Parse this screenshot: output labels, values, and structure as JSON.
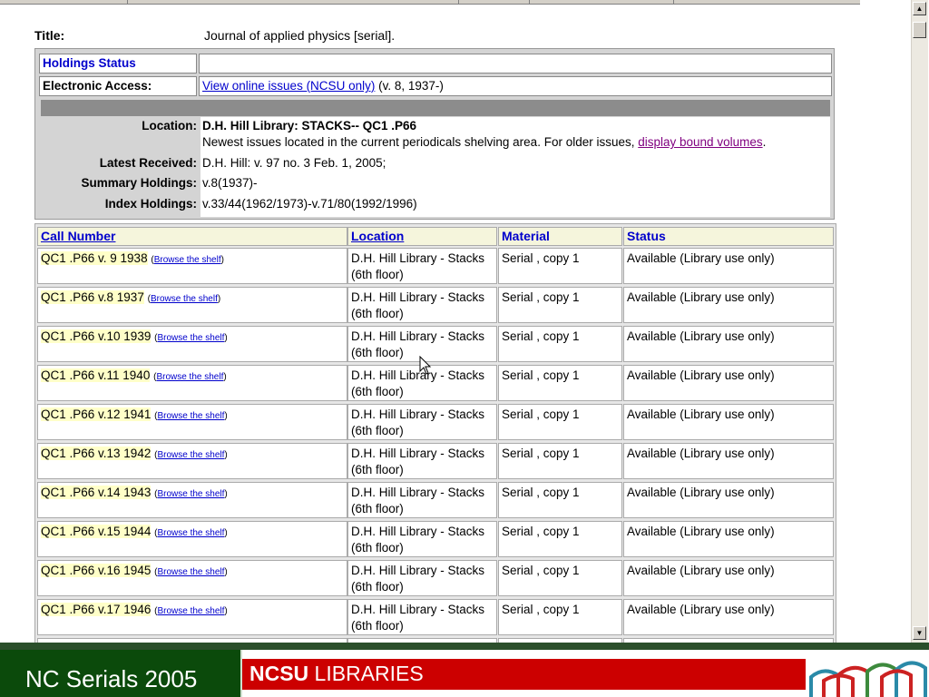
{
  "record": {
    "title_label": "Title:",
    "title_value": "Journal of applied physics [serial].",
    "holdings_status_label": "Holdings Status",
    "holdings_status_value": "",
    "electronic_access_label": "Electronic Access:",
    "electronic_access_link": "View online issues (NCSU only)",
    "electronic_access_note": "(v. 8, 1937-)",
    "location_label": "Location:",
    "location_value": "D.H. Hill Library: STACKS-- QC1 .P66",
    "location_note": "Newest issues located in the current periodicals shelving area. For older issues,",
    "location_link": "display bound volumes",
    "location_note_end": ".",
    "latest_received_label": "Latest Received:",
    "latest_received_value": "D.H. Hill: v. 97 no. 3 Feb. 1, 2005;",
    "summary_holdings_label": "Summary Holdings:",
    "summary_holdings_value": "v.8(1937)-",
    "index_holdings_label": "Index Holdings:",
    "index_holdings_value": "v.33/44(1962/1973)-v.71/80(1992/1996)"
  },
  "items_table": {
    "headers": [
      "Call Number",
      "Location",
      "Material",
      "Status"
    ],
    "browse_label": "Browse the shelf",
    "rows": [
      {
        "call": "QC1 .P66 v. 9 1938",
        "location1": "D.H. Hill Library - Stacks",
        "location2": "(6th floor)",
        "material": "Serial , copy 1",
        "status": "Available (Library use only)"
      },
      {
        "call": "QC1 .P66 v.8 1937",
        "location1": "D.H. Hill Library - Stacks",
        "location2": "(6th floor)",
        "material": "Serial , copy 1",
        "status": "Available (Library use only)"
      },
      {
        "call": "QC1 .P66 v.10 1939",
        "location1": "D.H. Hill Library - Stacks",
        "location2": "(6th floor)",
        "material": "Serial , copy 1",
        "status": "Available (Library use only)"
      },
      {
        "call": "QC1 .P66 v.11 1940",
        "location1": "D.H. Hill Library - Stacks",
        "location2": "(6th floor)",
        "material": "Serial , copy 1",
        "status": "Available (Library use only)"
      },
      {
        "call": "QC1 .P66 v.12 1941",
        "location1": "D.H. Hill Library - Stacks",
        "location2": "(6th floor)",
        "material": "Serial , copy 1",
        "status": "Available (Library use only)"
      },
      {
        "call": "QC1 .P66 v.13 1942",
        "location1": "D.H. Hill Library - Stacks",
        "location2": "(6th floor)",
        "material": "Serial , copy 1",
        "status": "Available (Library use only)"
      },
      {
        "call": "QC1 .P66 v.14 1943",
        "location1": "D.H. Hill Library - Stacks",
        "location2": "(6th floor)",
        "material": "Serial , copy 1",
        "status": "Available (Library use only)"
      },
      {
        "call": "QC1 .P66 v.15 1944",
        "location1": "D.H. Hill Library - Stacks",
        "location2": "(6th floor)",
        "material": "Serial , copy 1",
        "status": "Available (Library use only)"
      },
      {
        "call": "QC1 .P66 v.16 1945",
        "location1": "D.H. Hill Library - Stacks",
        "location2": "(6th floor)",
        "material": "Serial , copy 1",
        "status": "Available (Library use only)"
      },
      {
        "call": "QC1 .P66 v.17 1946",
        "location1": "D.H. Hill Library - Stacks",
        "location2": "(6th floor)",
        "material": "Serial , copy 1",
        "status": "Available (Library use only)"
      }
    ]
  },
  "footer": {
    "slide_title": "NC Serials 2005",
    "brand_bold": "NCSU",
    "brand_rest": " LIBRARIES"
  },
  "colors": {
    "link": "#0000cc",
    "visited_link": "#800080",
    "call_highlight": "#ffffc8",
    "footer_green": "#0b4a0b",
    "brand_red": "#cc0000"
  },
  "icons": {
    "scroll_up": "arrow-up-icon",
    "scroll_down": "arrow-down-icon",
    "cursor": "mouse-pointer-icon",
    "logo": "ncsu-libraries-book-logo"
  }
}
